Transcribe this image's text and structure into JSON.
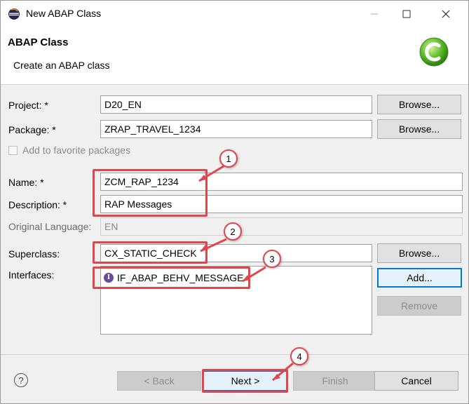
{
  "window": {
    "title": "New ABAP Class",
    "controls": {
      "minimize": "minimize-icon",
      "maximize": "maximize-icon",
      "close": "close-icon"
    }
  },
  "banner": {
    "title": "ABAP Class",
    "description": "Create an ABAP class",
    "icon": "abap-class-icon"
  },
  "form": {
    "project": {
      "label": "Project: *",
      "value": "D20_EN"
    },
    "package": {
      "label": "Package: *",
      "value": "ZRAP_TRAVEL_1234"
    },
    "favorite": {
      "label": "Add to favorite packages",
      "checked": false
    },
    "name": {
      "label": "Name: *",
      "value": "ZCM_RAP_1234"
    },
    "description": {
      "label": "Description: *",
      "value": "RAP Messages"
    },
    "original_language": {
      "label": "Original Language:",
      "value": "EN"
    },
    "superclass": {
      "label": "Superclass:",
      "value": "CX_STATIC_CHECK"
    },
    "interfaces": {
      "label": "Interfaces:",
      "items": [
        "IF_ABAP_BEHV_MESSAGE"
      ],
      "item_icon_glyph": "I"
    }
  },
  "buttons": {
    "browse": "Browse...",
    "add": "Add...",
    "remove": "Remove",
    "back": "< Back",
    "next": "Next >",
    "finish": "Finish",
    "cancel": "Cancel",
    "help": "?"
  },
  "annotations": {
    "callouts": [
      "1",
      "2",
      "3",
      "4"
    ],
    "color": "#e0474c"
  },
  "colors": {
    "focus": "#0078d7",
    "annotation": "#e0474c"
  }
}
